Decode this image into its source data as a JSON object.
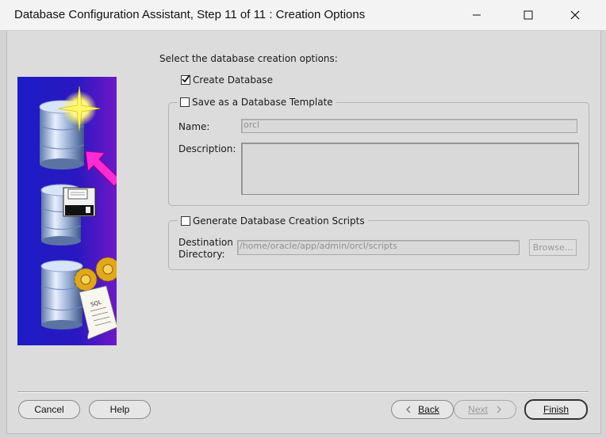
{
  "window": {
    "title": "Database Configuration Assistant, Step 11 of 11 : Creation Options"
  },
  "intro": "Select the database creation options:",
  "create_database": {
    "label": "Create Database",
    "checked": true
  },
  "template": {
    "label": "Save as a Database Template",
    "checked": false,
    "name_label": "Name:",
    "name_value": "orcl",
    "description_label": "Description:",
    "description_value": ""
  },
  "scripts": {
    "label": "Generate Database Creation Scripts",
    "checked": false,
    "destination_label_1": "Destination",
    "destination_label_2": "Directory:",
    "destination_value": "/home/oracle/app/admin/orcl/scripts",
    "browse_label": "Browse..."
  },
  "buttons": {
    "cancel": "Cancel",
    "help": "Help",
    "back": "Back",
    "next": "Next",
    "finish": "Finish"
  },
  "illustration": {
    "sql_text": "SQL"
  },
  "icons": [
    "minimize-icon",
    "maximize-icon",
    "close-icon",
    "checkmark-icon",
    "chevron-left-icon",
    "chevron-right-icon"
  ]
}
